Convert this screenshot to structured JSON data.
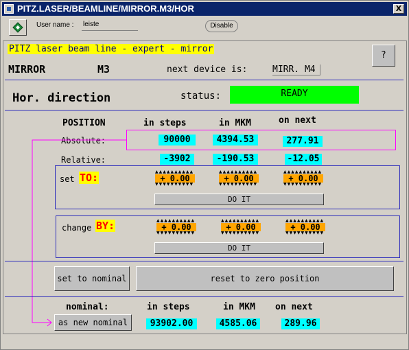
{
  "window": {
    "title": "PITZ.LASER/BEAMLINE/MIRROR.M3/HOR",
    "close_glyph": "X"
  },
  "toolbar": {
    "user_label": "User name :",
    "user_value": "leiste",
    "disable_label": "Disable"
  },
  "header": {
    "title": "PITZ laser beam line - expert - mirror",
    "device_name": "MIRROR",
    "device_id": "M3",
    "next_device_label": "next device is:",
    "next_device_value": "MIRR. M4",
    "help_label": "?"
  },
  "direction": {
    "label": "Hor. direction",
    "status_label": "status:",
    "status_value": "READY"
  },
  "position": {
    "header_label": "POSITION",
    "col_steps": "in steps",
    "col_mkm": "in MKM",
    "col_next": "on next",
    "absolute_label": "Absolute:",
    "absolute": {
      "steps": "90000",
      "mkm": "4394.53",
      "next": "277.91"
    },
    "relative_label": "Relative:",
    "relative": {
      "steps": "-3902",
      "mkm": "-190.53",
      "next": "-12.05"
    }
  },
  "set_to": {
    "label": "set",
    "keyword": "TO:",
    "steps": "+ 0.00",
    "mkm": "+ 0.00",
    "next": "+ 0.00",
    "do_it": "DO IT"
  },
  "change_by": {
    "label": "change",
    "keyword": "BY:",
    "steps": "+ 0.00",
    "mkm": "+ 0.00",
    "next": "+ 0.00",
    "do_it": "DO IT"
  },
  "actions": {
    "set_nominal": "set to nominal",
    "reset_zero": "reset to zero position"
  },
  "nominal": {
    "label": "nominal:",
    "col_steps": "in steps",
    "col_mkm": "in MKM",
    "col_next": "on next",
    "as_new_nominal": "as new nominal",
    "steps": "93902.00",
    "mkm": "4585.06",
    "next": "289.96"
  },
  "colors": {
    "title_bar": "#0a246a",
    "value_bg": "#00ffff",
    "status_bg": "#00ff00",
    "stepper_bg": "#ffa500",
    "keyword": "#ff0000",
    "frame_line": "#2c2cbb",
    "link_line": "#ff00ff"
  }
}
